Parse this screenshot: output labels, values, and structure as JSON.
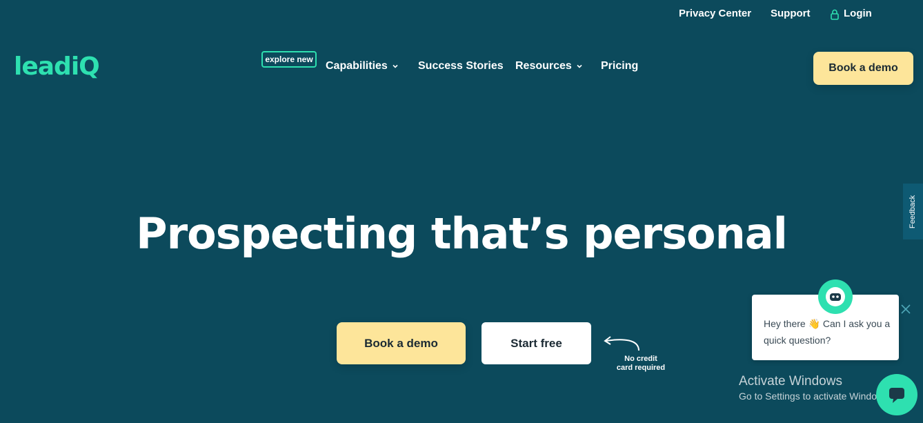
{
  "top_links": {
    "privacy": "Privacy Center",
    "support": "Support",
    "login": "Login"
  },
  "logo": "leadiQ",
  "nav": {
    "badge": "explore new",
    "capabilities": "Capabilities",
    "success_stories": "Success Stories",
    "resources": "Resources",
    "pricing": "Pricing"
  },
  "header_cta": "Book a demo",
  "hero": {
    "title": "Prospecting that’s personal",
    "primary_cta": "Book a demo",
    "secondary_cta": "Start free",
    "note_line1": "No credit",
    "note_line2": "card required"
  },
  "feedback_tab": "Feedback",
  "chat": {
    "message": "Hey there 👋 Can I ask you a quick question?"
  },
  "os_watermark": {
    "line1": "Activate Windows",
    "line2": "Go to Settings to activate Windows."
  },
  "colors": {
    "background": "#0c4a5c",
    "accent": "#2ee0b0",
    "cta": "#fde59a"
  }
}
